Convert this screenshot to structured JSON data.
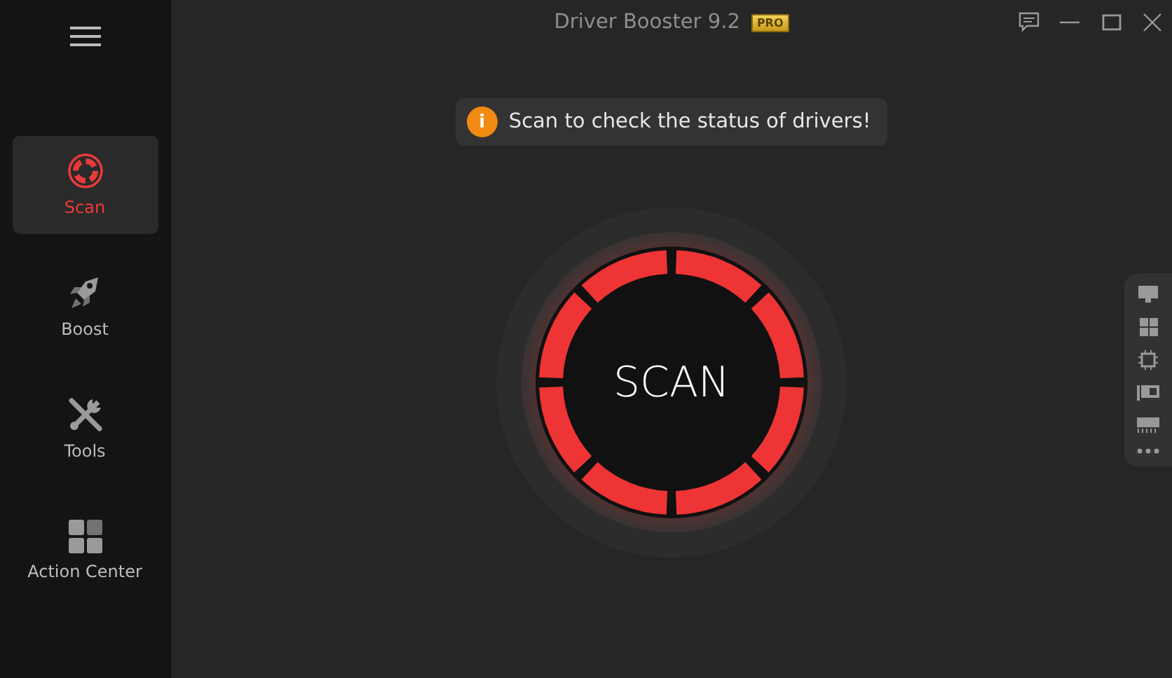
{
  "window": {
    "title": "Driver Booster 9.2",
    "badge": "PRO"
  },
  "sidebar": {
    "items": [
      {
        "label": "Scan",
        "selected": true
      },
      {
        "label": "Boost",
        "selected": false
      },
      {
        "label": "Tools",
        "selected": false
      },
      {
        "label": "Action Center",
        "selected": false
      }
    ]
  },
  "notice": {
    "text": "Scan to check the status of drivers!",
    "icon": "i"
  },
  "scan_button": {
    "label": "SCAN"
  }
}
